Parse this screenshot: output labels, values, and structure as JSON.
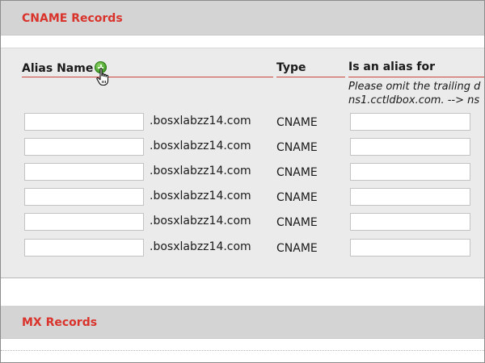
{
  "cname_section": {
    "title": "CNAME Records",
    "columns": {
      "alias_name": "Alias Name",
      "type": "Type",
      "is_alias_for": "Is an alias for"
    },
    "hint_line1": "Please omit the trailing d",
    "hint_line2": "ns1.cctldbox.com. --> ns",
    "rows": [
      {
        "suffix": ".bosxlabzz14.com",
        "type": "CNAME"
      },
      {
        "suffix": ".bosxlabzz14.com",
        "type": "CNAME"
      },
      {
        "suffix": ".bosxlabzz14.com",
        "type": "CNAME"
      },
      {
        "suffix": ".bosxlabzz14.com",
        "type": "CNAME"
      },
      {
        "suffix": ".bosxlabzz14.com",
        "type": "CNAME"
      },
      {
        "suffix": ".bosxlabzz14.com",
        "type": "CNAME"
      }
    ]
  },
  "mx_section": {
    "title": "MX Records"
  },
  "icons": {
    "add": "add-icon",
    "cursor": "hand-pointer-icon"
  },
  "colors": {
    "section_title": "#d9332b",
    "header_bg": "#d4d4d4",
    "panel_bg": "#ebebeb",
    "column_underline": "#c9453e",
    "add_icon": "#3c9a22"
  }
}
